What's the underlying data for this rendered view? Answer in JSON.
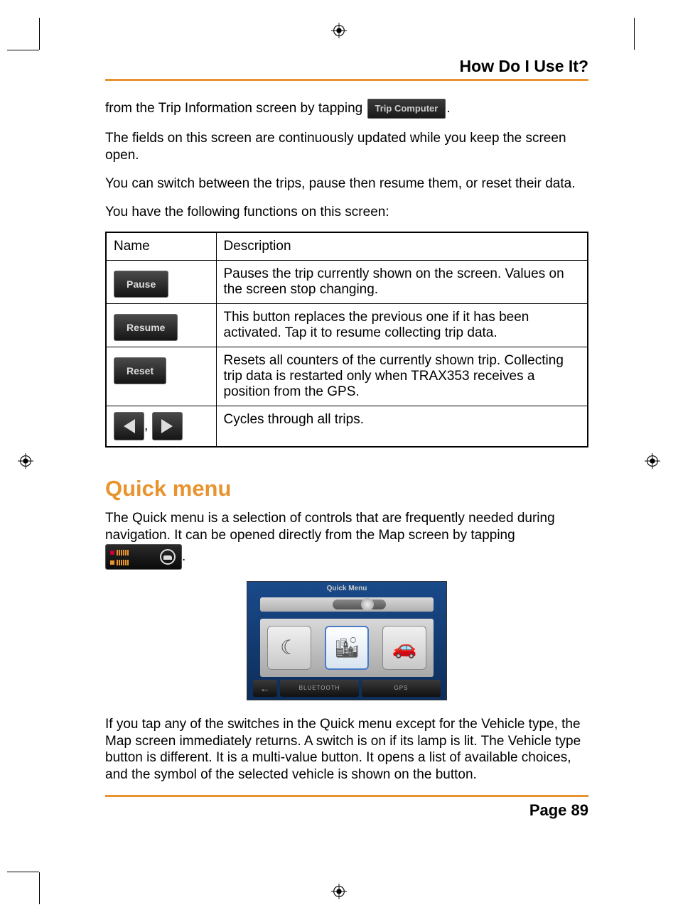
{
  "header": {
    "title": "How Do I Use It?"
  },
  "intro": {
    "p1_a": "from the Trip Information screen by tapping ",
    "trip_computer_label": "Trip Computer",
    "p1_b": ".",
    "p2": "The fields on this screen are continuously updated while you keep the screen open.",
    "p3": "You can switch between the trips, pause then resume them, or reset their data.",
    "p4": "You have the following functions on this screen:"
  },
  "table": {
    "head": {
      "c1": "Name",
      "c2": "Description"
    },
    "rows": [
      {
        "btn": "Pause",
        "desc": "Pauses the trip currently shown on the screen. Values on the screen stop changing."
      },
      {
        "btn": "Resume",
        "desc": "This button replaces the previous one if it has been activated. Tap it to resume collecting trip data."
      },
      {
        "btn": "Reset",
        "desc": "Resets all counters of the currently shown trip. Collecting trip data is restarted only when TRAX353 receives a position from the GPS."
      },
      {
        "btn_arrows": true,
        "comma": ",",
        "desc": "Cycles through all trips."
      }
    ]
  },
  "quick": {
    "heading": "Quick menu",
    "p1": "The Quick menu is a selection of controls that are frequently needed during navigation. It can be opened directly from the Map screen by tapping",
    "p1_end": ".",
    "screenshot": {
      "title": "Quick Menu",
      "bottom": {
        "bluetooth": "BLUETOOTH",
        "gps": "GPS"
      }
    },
    "p2": "If you tap any of the switches in the Quick menu except for the Vehicle type, the Map screen immediately returns. A switch is on if its lamp is lit. The Vehicle type button is different. It is a multi-value button. It opens a list of available choices, and the symbol of the selected vehicle is shown on the button."
  },
  "footer": {
    "page": "Page 89"
  }
}
